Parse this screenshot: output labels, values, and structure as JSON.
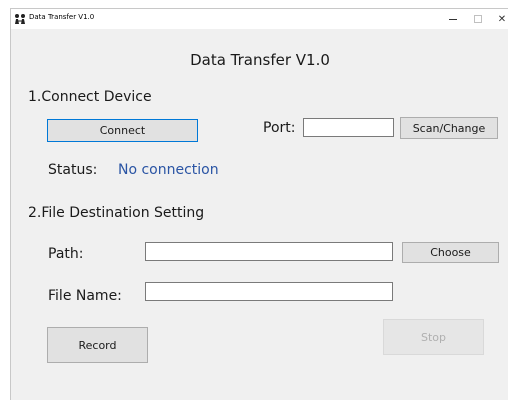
{
  "window": {
    "title": "Data Transfer V1.0",
    "minimize_glyph": "–",
    "close_glyph": "✕"
  },
  "heading": "Data Transfer V1.0",
  "connect_section": {
    "title": "1.Connect Device",
    "connect_button": "Connect",
    "port_label": "Port:",
    "port_value": "",
    "scan_button": "Scan/Change",
    "status_label": "Status:",
    "status_value": "No connection"
  },
  "destination_section": {
    "title": "2.File Destination Setting",
    "path_label": "Path:",
    "path_value": "",
    "choose_button": "Choose",
    "filename_label": "File Name:",
    "filename_value": ""
  },
  "actions": {
    "record_button": "Record",
    "stop_button": "Stop"
  },
  "colors": {
    "status_text": "#2a54a4",
    "focus_border": "#0078d7",
    "window_bg": "#f0f0f0"
  },
  "icons": {
    "app_icon": "people-transfer-icon"
  }
}
